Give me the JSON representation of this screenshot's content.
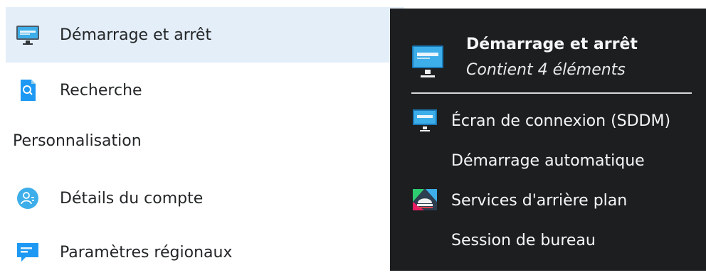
{
  "sidebar": {
    "items": [
      {
        "label": "Démarrage et arrêt",
        "icon": "monitor-icon",
        "selected": true
      },
      {
        "label": "Recherche",
        "icon": "search-document-icon",
        "selected": false
      },
      {
        "label": "Détails du compte",
        "icon": "user-account-icon",
        "selected": false
      },
      {
        "label": "Paramètres régionaux",
        "icon": "speech-bubble-icon",
        "selected": false
      }
    ],
    "section_header": "Personnalisation"
  },
  "tooltip": {
    "title": "Démarrage et arrêt",
    "subtitle": "Contient 4 éléments",
    "items": [
      {
        "label": "Écran de connexion (SDDM)",
        "icon": "monitor-icon"
      },
      {
        "label": "Démarrage automatique",
        "icon": ""
      },
      {
        "label": "Services d'arrière plan",
        "icon": "services-icon"
      },
      {
        "label": "Session de bureau",
        "icon": ""
      }
    ]
  },
  "colors": {
    "selection": "#e4eef8",
    "tooltip_bg": "#1d1e20",
    "accent_blue": "#3daee9"
  }
}
